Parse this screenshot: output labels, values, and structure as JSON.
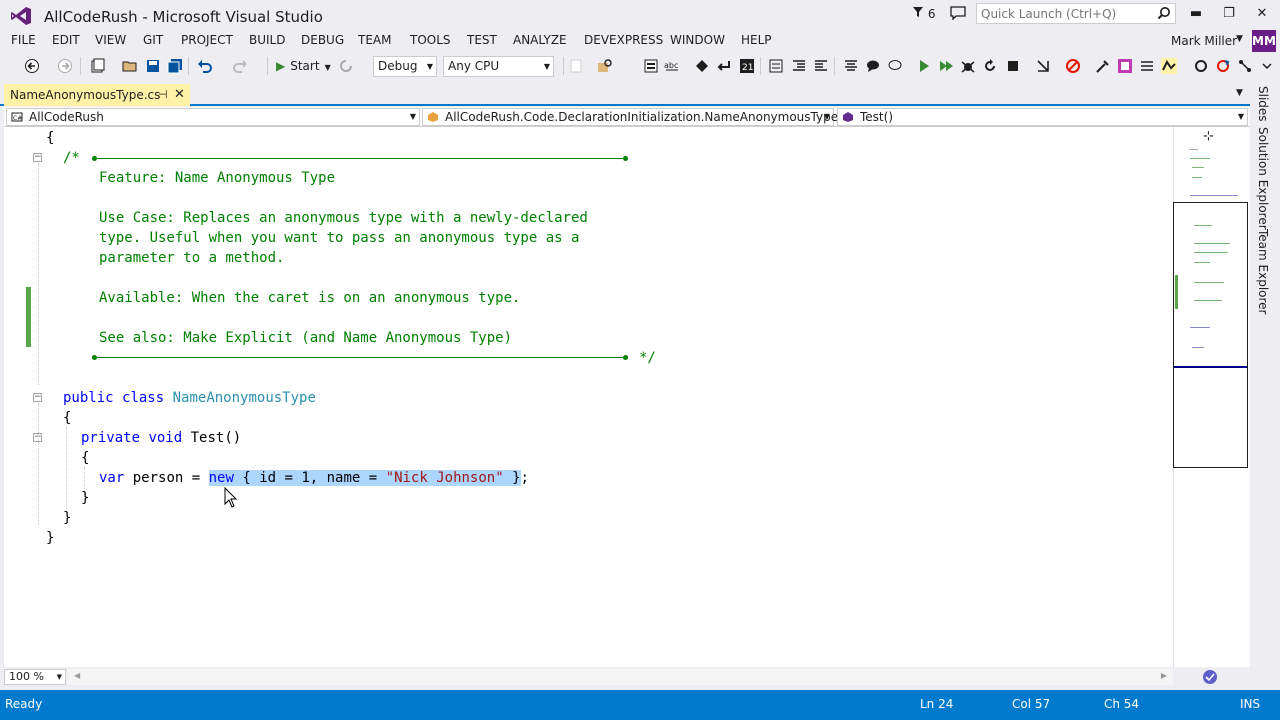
{
  "window": {
    "title": "AllCodeRush - Microsoft Visual Studio",
    "notification_count": "6",
    "quick_launch_placeholder": "Quick Launch (Ctrl+Q)",
    "minimize": "▬",
    "maximize": "❐",
    "close": "✕"
  },
  "menu": [
    "FILE",
    "EDIT",
    "VIEW",
    "GIT",
    "PROJECT",
    "BUILD",
    "DEBUG",
    "TEAM",
    "TOOLS",
    "TEST",
    "ANALYZE",
    "DEVEXPRESS",
    "WINDOW",
    "HELP"
  ],
  "user": {
    "name": "Mark Miller",
    "initials": "MM"
  },
  "toolbar": {
    "start_label": "Start",
    "configuration": "Debug",
    "platform": "Any CPU"
  },
  "document_tab": {
    "label": "NameAnonymousType.cs"
  },
  "navigation": {
    "project": "AllCodeRush",
    "type": "AllCodeRush.Code.DeclarationInitialization.NameAnonymousType",
    "member": "Test()"
  },
  "code": {
    "open_brace": "{",
    "comment_open": "/*",
    "comment_close": "*/",
    "feature": "Feature: Name Anonymous Type",
    "use_case_1": "Use Case: Replaces an anonymous type with a newly-declared",
    "use_case_2": "type. Useful when you want to pass an anonymous type as a",
    "use_case_3": "parameter to a method.",
    "available": "Available: When the caret is on an anonymous type.",
    "see_also": "See also: Make Explicit (and Name Anonymous Type)",
    "class_kw1": "public",
    "class_kw2": "class",
    "class_name": "NameAnonymousType",
    "class_open": "{",
    "method_kw1": "private",
    "method_kw2": "void",
    "method_sig": "Test()",
    "method_open": "{",
    "var_kw": "var",
    "var_decl": "person =",
    "new_kw": "new",
    "init_part1": "{ id = 1, name =",
    "init_string": "\"Nick Johnson\"",
    "init_part2": "}",
    "semicolon": ";",
    "method_close": "}",
    "class_close": "}",
    "ns_close": "}"
  },
  "side_tabs": [
    "Slides",
    "Solution Explorer",
    "Team Explorer"
  ],
  "zoom": "100 %",
  "status": {
    "state": "Ready",
    "line": "Ln 24",
    "col": "Col 57",
    "ch": "Ch 54",
    "mode": "INS"
  },
  "colors": {
    "accent": "#007acc",
    "keyword": "#0000ff",
    "type": "#2b91af",
    "comment": "#008000",
    "string": "#a31515",
    "selection": "#add6ff",
    "tab_active": "#fff1a6"
  }
}
